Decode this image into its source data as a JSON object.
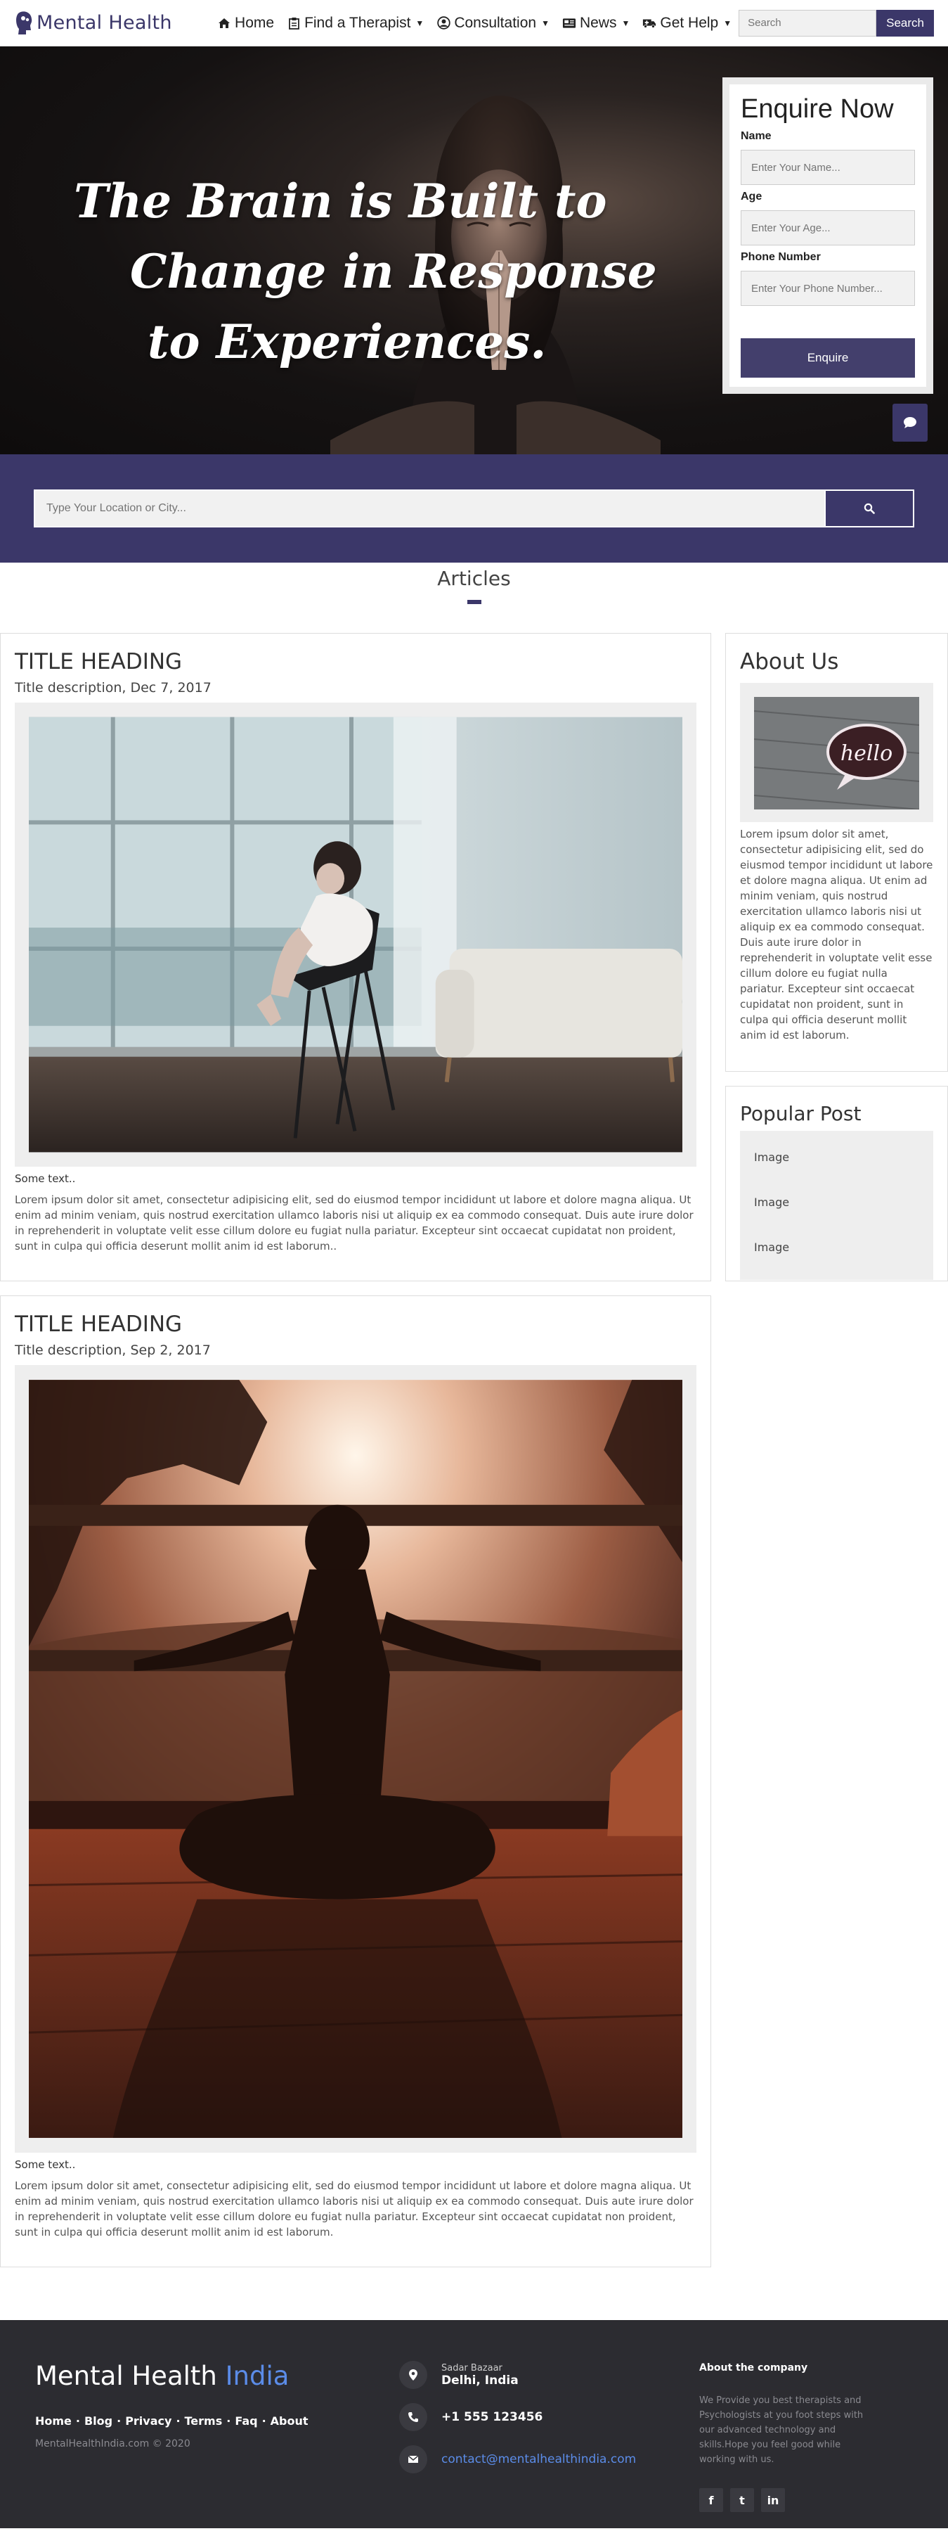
{
  "navbar": {
    "brand": "Mental Health",
    "items": [
      {
        "label": "Home",
        "icon": "home-icon",
        "caret": false
      },
      {
        "label": "Find a Therapist",
        "icon": "clipboard-icon",
        "caret": true
      },
      {
        "label": "Consultation",
        "icon": "user-circle-icon",
        "caret": true
      },
      {
        "label": "News",
        "icon": "newspaper-icon",
        "caret": true
      },
      {
        "label": "Get Help",
        "icon": "ambulance-icon",
        "caret": true
      }
    ],
    "search_placeholder": "Search",
    "search_button": "Search"
  },
  "hero": {
    "title_lines": [
      "The Brain is Built to",
      "Change in Response",
      "to Experiences."
    ]
  },
  "enquire": {
    "title": "Enquire Now",
    "fields": [
      {
        "label": "Name",
        "placeholder": "Enter Your Name..."
      },
      {
        "label": "Age",
        "placeholder": "Enter Your Age..."
      },
      {
        "label": "Phone Number",
        "placeholder": "Enter Your Phone Number..."
      }
    ],
    "button": "Enquire"
  },
  "location": {
    "placeholder": "Type Your Location or City..."
  },
  "articles": {
    "section_title": "Articles",
    "posts": [
      {
        "title": "TITLE HEADING",
        "description": "Title description, Dec 7, 2017",
        "some_text": "Some text..",
        "body": "Lorem ipsum dolor sit amet, consectetur adipisicing elit, sed do eiusmod tempor incididunt ut labore et dolore magna aliqua. Ut enim ad minim veniam, quis nostrud exercitation ullamco laboris nisi ut aliquip ex ea commodo consequat. Duis aute irure dolor in reprehenderit in voluptate velit esse cillum dolore eu fugiat nulla pariatur. Excepteur sint occaecat cupidatat non proident, sunt in culpa qui officia deserunt mollit anim id est laborum.."
      },
      {
        "title": "TITLE HEADING",
        "description": "Title description, Sep 2, 2017",
        "some_text": "Some text..",
        "body": "Lorem ipsum dolor sit amet, consectetur adipisicing elit, sed do eiusmod tempor incididunt ut labore et dolore magna aliqua. Ut enim ad minim veniam, quis nostrud exercitation ullamco laboris nisi ut aliquip ex ea commodo consequat. Duis aute irure dolor in reprehenderit in voluptate velit esse cillum dolore eu fugiat nulla pariatur. Excepteur sint occaecat cupidatat non proident, sunt in culpa qui officia deserunt mollit anim id est laborum."
      }
    ]
  },
  "sidebar": {
    "about_title": "About Us",
    "about_image_text": "hello",
    "about_text": "Lorem ipsum dolor sit amet, consectetur adipisicing elit, sed do eiusmod tempor incididunt ut labore et dolore magna aliqua. Ut enim ad minim veniam, quis nostrud exercitation ullamco laboris nisi ut aliquip ex ea commodo consequat. Duis aute irure dolor in reprehenderit in voluptate velit esse cillum dolore eu fugiat nulla pariatur. Excepteur sint occaecat cupidatat non proident, sunt in culpa qui officia deserunt mollit anim id est laborum.",
    "popular_title": "Popular Post",
    "popular_items": [
      "Image",
      "Image",
      "Image"
    ]
  },
  "footer": {
    "brand_main": "Mental Health",
    "brand_accent": "India",
    "links": [
      "Home",
      "Blog",
      "Privacy",
      "Terms",
      "Faq",
      "About"
    ],
    "copyright": "MentalHealthIndia.com © 2020",
    "address_line1": "Sadar Bazaar",
    "address_line2": "Delhi, India",
    "phone": "+1 555 123456",
    "email": "contact@mentalhealthindia.com",
    "about_title": "About the company",
    "about_text": "We Provide you best therapists and Psychologists at you foot steps with our advanced technology and skills.Hope you feel good while working with us.",
    "socials": [
      "f",
      "t",
      "in"
    ]
  },
  "colors": {
    "brand": "#3b3769",
    "accent_link": "#5b8ce8",
    "footer_bg": "#2c2c31"
  }
}
